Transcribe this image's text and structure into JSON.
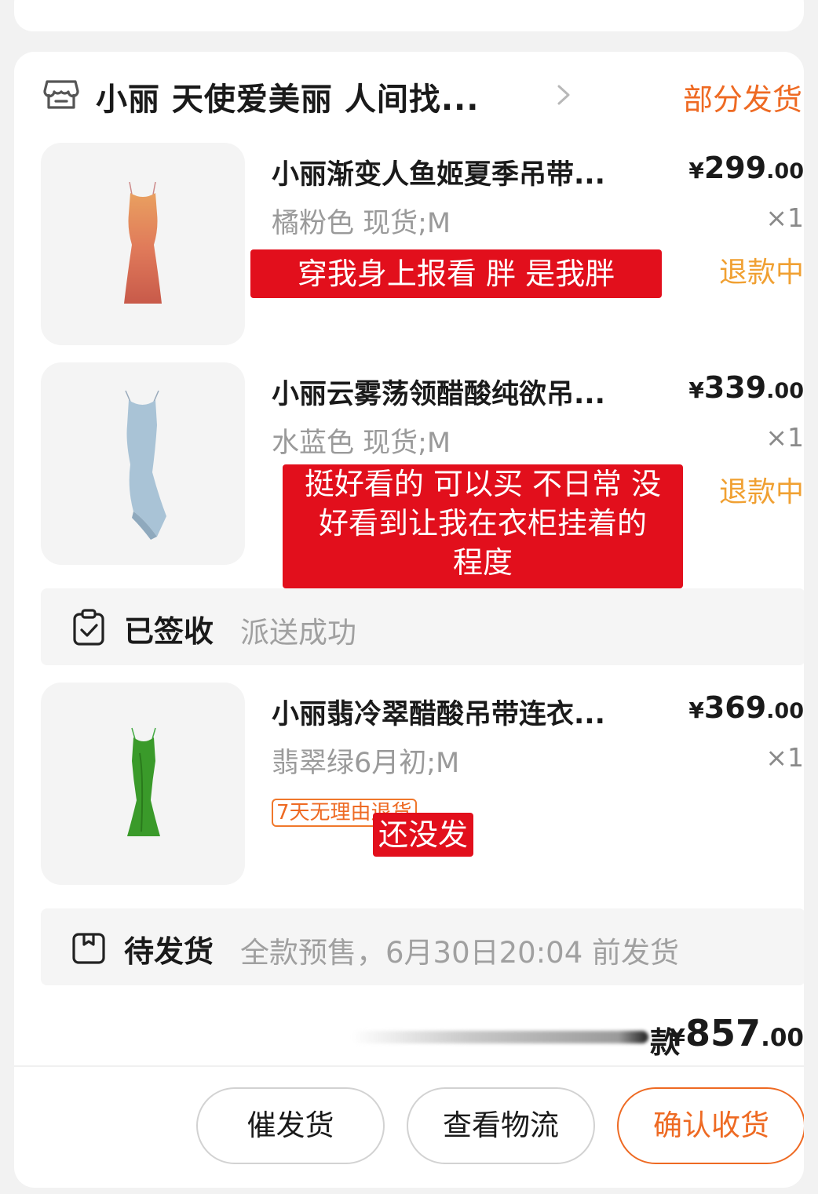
{
  "shop": {
    "name": "小丽 天使爱美丽 人间找...",
    "status": "部分发货"
  },
  "items": [
    {
      "title": "小丽渐变人鱼姬夏季吊带...",
      "spec": "橘粉色 现货;M",
      "price_currency": "¥",
      "price_int": "299",
      "price_dec": ".00",
      "qty": "×1",
      "status": "退款中",
      "dress_color": "#e08060"
    },
    {
      "title": "小丽云雾荡领醋酸纯欲吊...",
      "spec": "水蓝色 现货;M",
      "price_currency": "¥",
      "price_int": "339",
      "price_dec": ".00",
      "qty": "×1",
      "status": "退款中",
      "dress_color": "#a9c3d6"
    },
    {
      "title": "小丽翡冷翠醋酸吊带连衣...",
      "spec": "翡翠绿6月初;M",
      "price_currency": "¥",
      "price_int": "369",
      "price_dec": ".00",
      "qty": "×1",
      "tag": "7天无理由退货",
      "dress_color": "#3a9a2a"
    }
  ],
  "overlays": {
    "item1": "穿我身上报看 胖 是我胖",
    "item2_line1": "挺好看的 可以买 不日常 没",
    "item2_line2": "好看到让我在衣柜挂着的",
    "item2_line3": "程度",
    "item3": "还没发"
  },
  "signed_status": {
    "title": "已签收",
    "desc": "派送成功",
    "icon": "clipboard-check-icon"
  },
  "pending_status": {
    "title": "待发货",
    "desc": "全款预售，6月30日20:04 前发货",
    "icon": "package-icon"
  },
  "total": {
    "label": "款",
    "currency": "¥",
    "int": "857",
    "dec": ".00"
  },
  "buttons": {
    "remind": "催发货",
    "logistics": "查看物流",
    "confirm": "确认收货"
  },
  "colors": {
    "accent": "#ee6a23",
    "refund": "#f0a032",
    "overlay_red": "#e20f1c"
  }
}
